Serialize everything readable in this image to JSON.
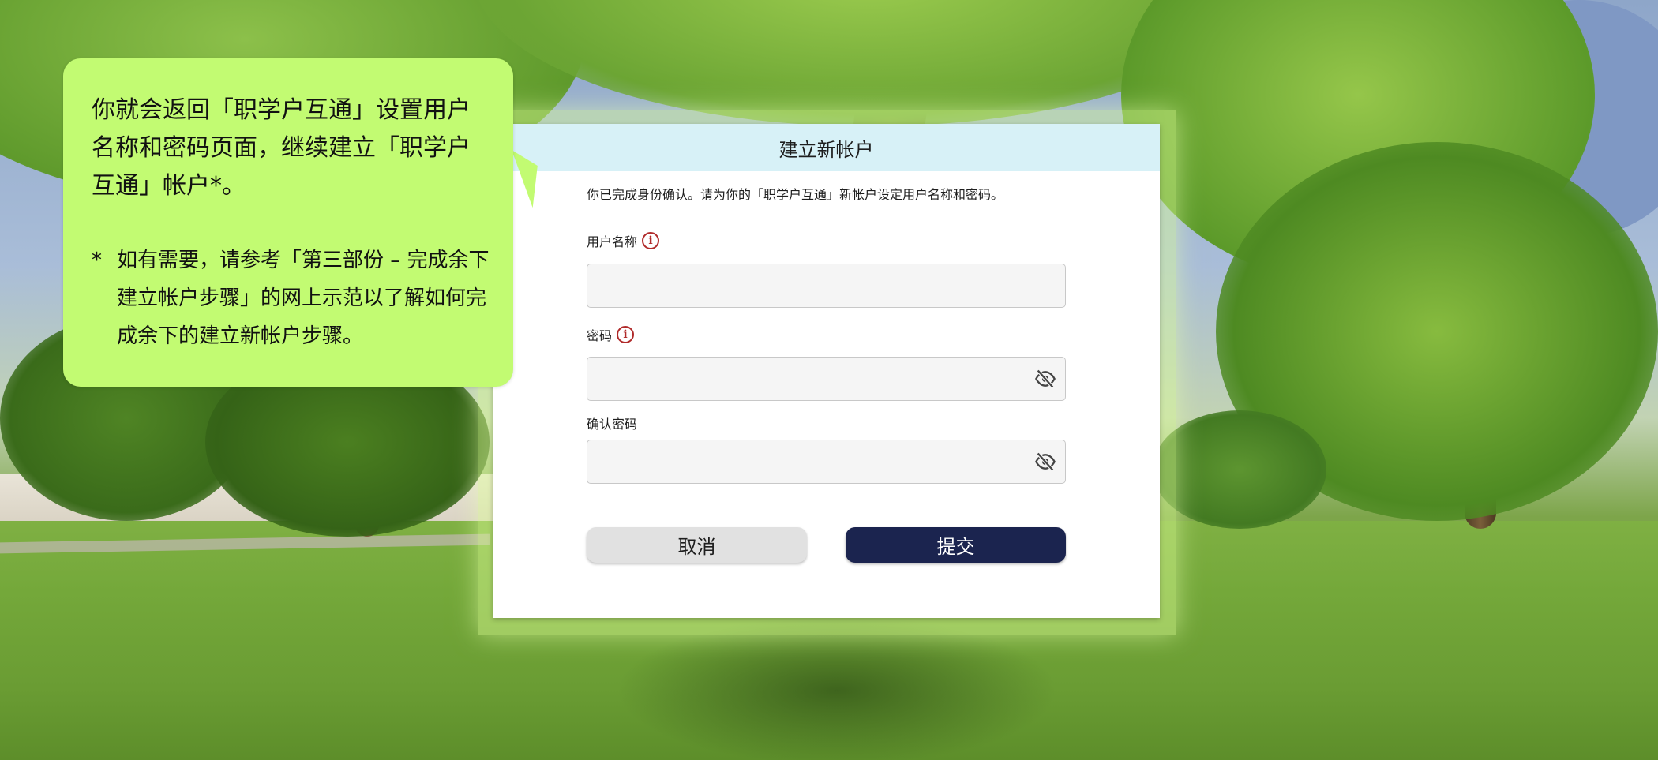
{
  "dialog": {
    "title": "建立新帐户",
    "intro": "你已完成身份确认。请为你的「职学户互通」新帐户设定用户名称和密码。",
    "username": {
      "label": "用户名称",
      "value": ""
    },
    "password": {
      "label": "密码",
      "value": ""
    },
    "confirm_password": {
      "label": "确认密码",
      "value": ""
    },
    "cancel_label": "取消",
    "submit_label": "提交"
  },
  "callout": {
    "main": "你就会返回「职学户互通」设置用户名称和密码页面，继续建立「职学户互通」帐户*。",
    "note_marker": "*",
    "note": "如有需要，请参考「第三部份 – 完成余下建立帐户步骤」的网上示范以了解如何完成余下的建立新帐户步骤。"
  },
  "icons": {
    "info": "info-circle-icon",
    "password_toggle": "eye-slash-icon"
  },
  "colors": {
    "header_bg": "#d7f1f7",
    "submit_bg": "#1b244f",
    "cancel_bg": "#e1e1e1",
    "callout_bg": "#c2fb72",
    "info_icon": "#b02a2a"
  }
}
